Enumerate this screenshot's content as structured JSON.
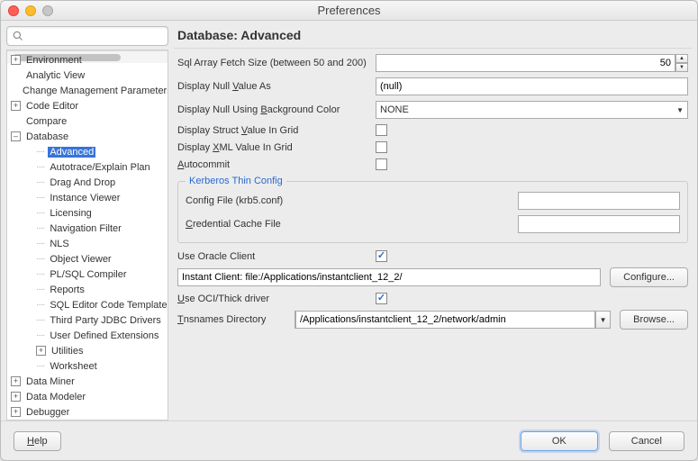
{
  "window": {
    "title": "Preferences"
  },
  "search": {
    "placeholder": ""
  },
  "tree": {
    "items": [
      {
        "label": "Environment",
        "toggle": "+",
        "level": 1
      },
      {
        "label": "Analytic View",
        "toggle": "—",
        "level": 1
      },
      {
        "label": "Change Management Parameters",
        "toggle": "—",
        "level": 1
      },
      {
        "label": "Code Editor",
        "toggle": "+",
        "level": 1
      },
      {
        "label": "Compare",
        "toggle": "—",
        "level": 1
      },
      {
        "label": "Database",
        "toggle": "–",
        "level": 1,
        "expanded": true
      },
      {
        "label": "Advanced",
        "level": 2,
        "selected": true
      },
      {
        "label": "Autotrace/Explain Plan",
        "level": 2
      },
      {
        "label": "Drag And Drop",
        "level": 2
      },
      {
        "label": "Instance Viewer",
        "level": 2
      },
      {
        "label": "Licensing",
        "level": 2
      },
      {
        "label": "Navigation Filter",
        "level": 2
      },
      {
        "label": "NLS",
        "level": 2
      },
      {
        "label": "Object Viewer",
        "level": 2
      },
      {
        "label": "PL/SQL Compiler",
        "level": 2
      },
      {
        "label": "Reports",
        "level": 2
      },
      {
        "label": "SQL Editor Code Templates",
        "level": 2
      },
      {
        "label": "Third Party JDBC Drivers",
        "level": 2
      },
      {
        "label": "User Defined Extensions",
        "level": 2
      },
      {
        "label": "Utilities",
        "toggle": "+",
        "level": 2
      },
      {
        "label": "Worksheet",
        "level": 2
      },
      {
        "label": "Data Miner",
        "toggle": "+",
        "level": 1
      },
      {
        "label": "Data Modeler",
        "toggle": "+",
        "level": 1
      },
      {
        "label": "Debugger",
        "toggle": "+",
        "level": 1
      }
    ]
  },
  "panel": {
    "heading": "Database: Advanced",
    "sqlArrayLabel": "Sql Array Fetch Size (between 50 and 200)",
    "sqlArrayValue": "50",
    "nullValueLabel_pre": "Display Null ",
    "nullValueLabel_u": "V",
    "nullValueLabel_post": "alue As",
    "nullValueValue": "(null)",
    "nullBgLabel_pre": "Display Null Using ",
    "nullBgLabel_u": "B",
    "nullBgLabel_post": "ackground Color",
    "nullBgValue": "NONE",
    "structLabel_pre": "Display Struct ",
    "structLabel_u": "V",
    "structLabel_post": "alue In Grid",
    "xmlLabel_pre": "Display ",
    "xmlLabel_u": "X",
    "xmlLabel_post": "ML Value In Grid",
    "autocommit_u": "A",
    "autocommit_post": "utocommit",
    "kerberosLegend": "Kerberos Thin Config",
    "configFile_pre": "Confi",
    "configFile_u": "g",
    "configFile_post": " File (krb5.conf)",
    "credCache_u": "C",
    "credCache_post": "redential Cache File",
    "useOracleLabel": "Use Oracle Client",
    "oracleClientValue": "Instant Client: file:/Applications/instantclient_12_2/",
    "configureBtn": "Configure...",
    "useOciLabel_u": "U",
    "useOciLabel_post": "se OCI/Thick driver",
    "tnsLabel_u": "T",
    "tnsLabel_post": "nsnames Directory",
    "tnsValue": "/Applications/instantclient_12_2/network/admin",
    "browseBtn": "Browse..."
  },
  "footer": {
    "help_u": "H",
    "help_post": "elp",
    "ok": "OK",
    "cancel": "Cancel"
  }
}
